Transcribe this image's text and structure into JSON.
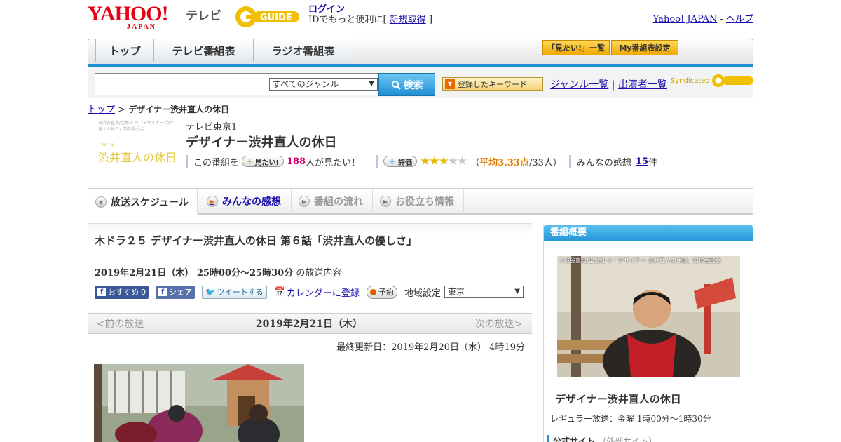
{
  "header": {
    "logo_yahoo": "YAHOO!",
    "logo_japan": "JAPAN",
    "logo_tv": "テレビ",
    "logo_gguide": "GUIDE",
    "login": "ログイン",
    "login_prefix": "IDでもっと便利に[",
    "register": "新規取得",
    "login_suffix": "]",
    "yahoo_japan": "Yahoo! JAPAN",
    "separator": " - ",
    "help": "ヘルプ"
  },
  "nav": {
    "tabs": [
      "トップ",
      "テレビ番組表",
      "ラジオ番組表"
    ],
    "mitai_list": "「見たい!」一覧",
    "my_schedule": "My番組表設定"
  },
  "search": {
    "genre": "すべてのジャンル",
    "button": "検索",
    "keyword_button": "登録したキーワード",
    "genre_list": "ジャンル一覧",
    "divider": "|",
    "cast_list": "出演者一覧",
    "syndicated": "Syndicated"
  },
  "breadcrumb": {
    "top": "トップ",
    "sep": " > ",
    "current": "デザイナー渋井直人の休日"
  },
  "program": {
    "thumb_small": "名渋谷直角/宝島社 ©「デザイナー 渋井直人の休日」製作委員会",
    "thumb_sub": "デザイナー",
    "thumb_title": "渋井直人の休日",
    "channel": "テレビ東京1",
    "title": "デザイナー渋井直人の休日",
    "mitai_prefix": "この番組を",
    "mitai_button": "見たい!",
    "mitai_count": "188",
    "mitai_suffix": "人が見たい！",
    "rating_button": "評価",
    "rating_value": 3.33,
    "rating_open": "（",
    "rating_avg": "平均3.33点",
    "rating_count": "/33人）",
    "review_prefix": "みんなの感想",
    "review_count": "15",
    "review_suffix": "件"
  },
  "tabs": [
    "放送スケジュール",
    "みんなの感想",
    "番組の流れ",
    "お役立ち情報"
  ],
  "episode": {
    "title": "木ドラ２５ デザイナー渋井直人の休日 第６話「渋井直人の優しさ」",
    "date": "2019年2月21日（木） 25時00分～25時30分",
    "date_suffix": "の放送内容",
    "fb_recommend": "おすすめ",
    "fb_count": "0",
    "fb_share": "シェア",
    "tweet": "ツイートする",
    "calendar": "カレンダーに登録",
    "reserve": "予約",
    "region_label": "地域設定",
    "region": "東京"
  },
  "date_nav": {
    "prev": "<前の放送",
    "current": "2019年2月21日（木）",
    "next": "次の放送>"
  },
  "last_updated": "最終更新日：2019年2月20日（水） 4時19分",
  "sidebar": {
    "heading": "番組概要",
    "photo_credit": "©渋谷直角/宝島社 ©「デザイナー 渋井直人の休日」製作委員会",
    "title": "デザイナー渋井直人の休日",
    "regular": "レギュラー放送：金曜 1時00分～1時30分",
    "official": "公式サイト",
    "official_ext": "（外部サイト）"
  },
  "colors": {
    "accent_blue": "#1e8fd6",
    "link": "#1a0dab",
    "yahoo_red": "#e60012",
    "star": "#e6b800"
  }
}
